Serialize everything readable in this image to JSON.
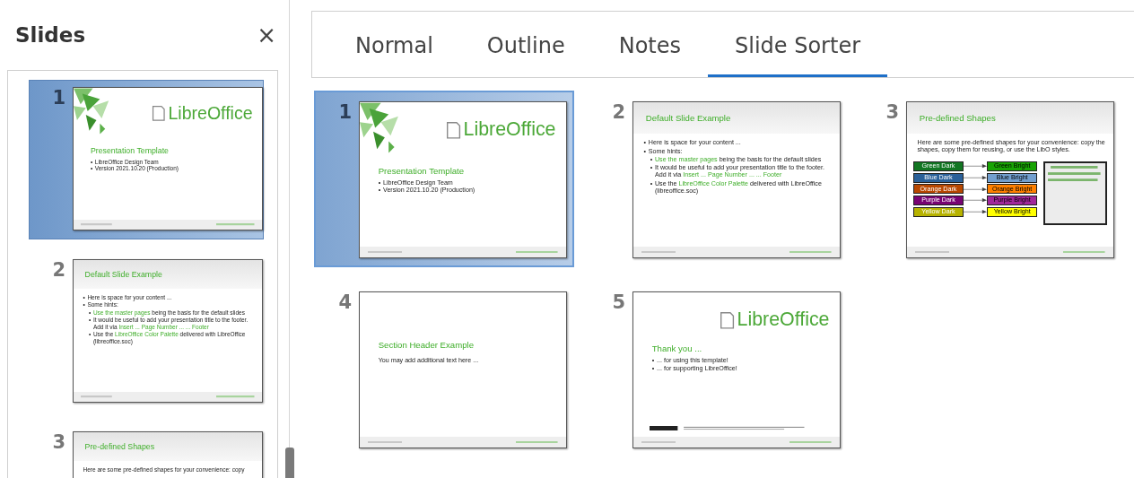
{
  "sidebar": {
    "title": "Slides",
    "close": "×",
    "items": [
      {
        "number": "1",
        "selected": true,
        "kind": "title",
        "logo": "LibreOffice",
        "title": "Presentation Template",
        "bullets": [
          {
            "marker": "•",
            "text": "LibreOffice Design Team"
          },
          {
            "marker": "•",
            "text": "Version 2021.10.20 (Production)"
          }
        ]
      },
      {
        "number": "2",
        "selected": false,
        "kind": "content",
        "title": "Default Slide Example",
        "bullets": [
          {
            "marker": "•",
            "text": "Here is space for your content ..."
          },
          {
            "marker": "•",
            "text": "Some hints:",
            "children": [
              {
                "marker": "•",
                "parts": [
                  {
                    "text": "Use the master pages",
                    "accent": true
                  },
                  {
                    "text": " being the basis for the default slides",
                    "accent": false
                  }
                ]
              },
              {
                "marker": "•",
                "parts": [
                  {
                    "text": "It would be useful to add your presentation title to the footer. Add it via ",
                    "accent": false
                  },
                  {
                    "text": "Insert ... Page Number ... ... Footer",
                    "accent": true
                  }
                ]
              },
              {
                "marker": "•",
                "parts": [
                  {
                    "text": "Use the ",
                    "accent": false
                  },
                  {
                    "text": "LibreOffice Color Palette",
                    "accent": true
                  },
                  {
                    "text": " delivered with LibreOffice (libreoffice.soc)",
                    "accent": false
                  }
                ]
              }
            ]
          }
        ]
      },
      {
        "number": "3",
        "selected": false,
        "kind": "shapes",
        "title": "Pre-defined Shapes",
        "body": "Here are some pre-defined shapes for your convenience: copy"
      }
    ]
  },
  "tabs": [
    {
      "label": "Normal",
      "selected": false
    },
    {
      "label": "Outline",
      "selected": false
    },
    {
      "label": "Notes",
      "selected": false
    },
    {
      "label": "Slide Sorter",
      "selected": true
    }
  ],
  "sorter": {
    "items": [
      {
        "number": "1",
        "selected": true,
        "kind": "title",
        "logo": "LibreOffice",
        "title": "Presentation Template",
        "bullets": [
          {
            "marker": "•",
            "text": "LibreOffice Design Team"
          },
          {
            "marker": "•",
            "text": "Version 2021.10.20 (Production)"
          }
        ]
      },
      {
        "number": "2",
        "selected": false,
        "kind": "content",
        "title": "Default Slide Example",
        "bullets": [
          {
            "marker": "•",
            "text": "Here is space for your content ..."
          },
          {
            "marker": "•",
            "text": "Some hints:",
            "children": [
              {
                "marker": "•",
                "parts": [
                  {
                    "text": "Use the master pages",
                    "accent": true
                  },
                  {
                    "text": " being the basis for the default slides",
                    "accent": false
                  }
                ]
              },
              {
                "marker": "•",
                "parts": [
                  {
                    "text": "It would be useful to add your presentation title to the footer. Add it via ",
                    "accent": false
                  },
                  {
                    "text": "Insert ... Page Number ... ... Footer",
                    "accent": true
                  }
                ]
              },
              {
                "marker": "•",
                "parts": [
                  {
                    "text": "Use the ",
                    "accent": false
                  },
                  {
                    "text": "LibreOffice Color Palette",
                    "accent": true
                  },
                  {
                    "text": " delivered with LibreOffice (libreoffice.soc)",
                    "accent": false
                  }
                ]
              }
            ]
          }
        ]
      },
      {
        "number": "3",
        "selected": false,
        "kind": "shapes",
        "title": "Pre-defined Shapes",
        "body": "Here are some pre-defined shapes for your convenience: copy the shapes, copy them for reusing, or use the LibO styles.",
        "shapes": [
          {
            "dark": {
              "label": "Green Dark",
              "color": "#127622"
            },
            "bright": {
              "label": "Green Bright",
              "color": "#18a303"
            }
          },
          {
            "dark": {
              "label": "Blue Dark",
              "color": "#2a6099"
            },
            "bright": {
              "label": "Blue Bright",
              "color": "#729fcf"
            }
          },
          {
            "dark": {
              "label": "Orange Dark",
              "color": "#b84700"
            },
            "bright": {
              "label": "Orange Bright",
              "color": "#ff8000"
            }
          },
          {
            "dark": {
              "label": "Purple Dark",
              "color": "#780373"
            },
            "bright": {
              "label": "Purple Bright",
              "color": "#a1279b"
            }
          },
          {
            "dark": {
              "label": "Yellow Dark",
              "color": "#b7b300"
            },
            "bright": {
              "label": "Yellow Bright",
              "color": "#ffff00"
            }
          }
        ]
      },
      {
        "number": "4",
        "selected": false,
        "kind": "section",
        "title": "Section Header Example",
        "body": "You may add additional text here ..."
      },
      {
        "number": "5",
        "selected": false,
        "kind": "closing",
        "logo": "LibreOffice",
        "title": "Thank you ...",
        "bullets": [
          {
            "marker": "•",
            "text": "... for using this template!"
          },
          {
            "marker": "•",
            "text": "... for supporting LibreOffice!"
          }
        ]
      }
    ]
  }
}
